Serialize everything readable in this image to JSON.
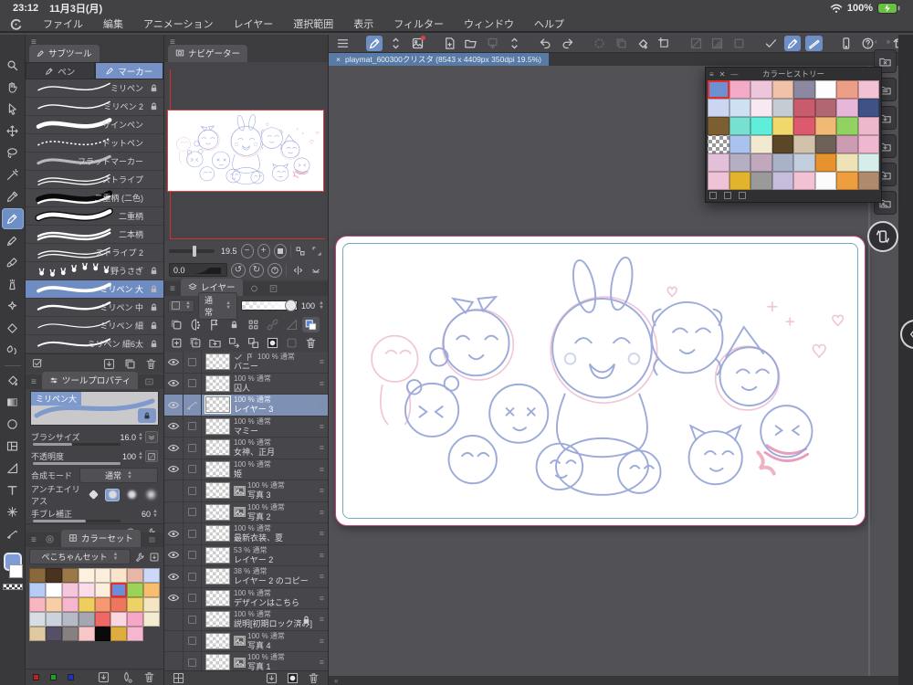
{
  "status_bar": {
    "time": "23:12",
    "date": "11月3日(月)",
    "battery": "100%"
  },
  "menu": {
    "items": [
      "ファイル",
      "編集",
      "アニメーション",
      "レイヤー",
      "選択範囲",
      "表示",
      "フィルター",
      "ウィンドウ",
      "ヘルプ"
    ]
  },
  "top_toolbar": {
    "buttons": [
      {
        "icon": "menu",
        "state": "normal"
      },
      {
        "icon": "pen-edit",
        "state": "active",
        "gap": true
      },
      {
        "icon": "chevrons",
        "state": "normal"
      },
      {
        "icon": "gallery",
        "state": "normal",
        "badge": true
      },
      {
        "icon": "new-doc",
        "state": "normal",
        "gap": true
      },
      {
        "icon": "folder-open",
        "state": "normal"
      },
      {
        "icon": "export",
        "state": "dim"
      },
      {
        "icon": "chevrons",
        "state": "normal"
      },
      {
        "icon": "undo",
        "state": "normal",
        "gap": true
      },
      {
        "icon": "redo",
        "state": "normal"
      },
      {
        "icon": "process",
        "state": "dim",
        "gap": true
      },
      {
        "icon": "duplicate",
        "state": "dim"
      },
      {
        "icon": "fill-tool",
        "state": "normal"
      },
      {
        "icon": "transform",
        "state": "normal"
      },
      {
        "icon": "select-slash",
        "state": "dim",
        "gap": true
      },
      {
        "icon": "select-half",
        "state": "dim"
      },
      {
        "icon": "select-box",
        "state": "dim"
      },
      {
        "icon": "snap-check",
        "state": "normal",
        "gap": true
      },
      {
        "icon": "snap-pen",
        "state": "active"
      },
      {
        "icon": "snap-ruler",
        "state": "active"
      },
      {
        "icon": "tablet",
        "state": "normal",
        "gap": true
      },
      {
        "icon": "help",
        "state": "normal"
      },
      {
        "icon": "rotate-canvas",
        "state": "normal",
        "gap": true
      }
    ]
  },
  "document": {
    "close_label": "×",
    "tab_title": "playmat_600300クリスタ (8543 x 4409px 350dpi 19.5%)"
  },
  "left_toolbar": {
    "foreground_color": "#7f9bd8",
    "background_color": "#ffffff",
    "tools": [
      {
        "name": "zoom",
        "icon": "magnifier"
      },
      {
        "name": "hand",
        "icon": "hand"
      },
      {
        "name": "operate",
        "icon": "cursor"
      },
      {
        "name": "move",
        "icon": "move"
      },
      {
        "name": "selection",
        "icon": "lasso"
      },
      {
        "name": "auto-select",
        "icon": "wand"
      },
      {
        "name": "eyedropper",
        "icon": "dropper"
      },
      {
        "name": "pen",
        "icon": "pen",
        "active": true
      },
      {
        "name": "pencil",
        "icon": "pencil"
      },
      {
        "name": "brush",
        "icon": "brush"
      },
      {
        "name": "airbrush",
        "icon": "spray"
      },
      {
        "name": "decoration",
        "icon": "sparkle"
      },
      {
        "name": "eraser",
        "icon": "eraser"
      },
      {
        "name": "blend",
        "icon": "blend",
        "divider_after": true
      },
      {
        "name": "fill",
        "icon": "bucket"
      },
      {
        "name": "gradient",
        "icon": "gradient"
      },
      {
        "name": "figure",
        "icon": "shape-circle"
      },
      {
        "name": "frame-border",
        "icon": "frame"
      },
      {
        "name": "ruler",
        "icon": "ruler"
      },
      {
        "name": "text",
        "icon": "text"
      },
      {
        "name": "balloon",
        "icon": "asterisk"
      },
      {
        "name": "line-correct",
        "icon": "line-fix"
      }
    ]
  },
  "subtool": {
    "title": "サブツール",
    "tabs": [
      {
        "label": "ペン",
        "active": false
      },
      {
        "label": "マーカー",
        "active": true
      }
    ],
    "brushes": [
      {
        "name": "ミリペン",
        "locked": true,
        "preview": "thin"
      },
      {
        "name": "ミリペン 2",
        "locked": true,
        "preview": "thin"
      },
      {
        "name": "サインペン",
        "locked": false,
        "preview": "thick"
      },
      {
        "name": "ドットペン",
        "locked": false,
        "preview": "dotted"
      },
      {
        "name": "フラットマーカー",
        "locked": false,
        "preview": "flat"
      },
      {
        "name": "ストライプ",
        "locked": false,
        "preview": "stripe"
      },
      {
        "name": "二重柄 (二色)",
        "locked": false,
        "preview": "dual"
      },
      {
        "name": "二重柄",
        "locked": false,
        "preview": "outline"
      },
      {
        "name": "二本柄",
        "locked": false,
        "preview": "twoline"
      },
      {
        "name": "ストライプ 2",
        "locked": false,
        "preview": "stripe2"
      },
      {
        "name": "野うさぎ",
        "locked": true,
        "preview": "bunny"
      },
      {
        "name": "ミリペン 大",
        "locked": true,
        "preview": "big",
        "selected": true
      },
      {
        "name": "ミリペン 中",
        "locked": true,
        "preview": "mid"
      },
      {
        "name": "ミリペン 細",
        "locked": true,
        "preview": "fine"
      },
      {
        "name": "ミリペン 細6太",
        "locked": true,
        "preview": "taper"
      }
    ],
    "footer_icons": [
      "checkbox-pen",
      "import-down",
      "duplicate",
      "trash"
    ]
  },
  "tool_property": {
    "title": "ツールプロパティ",
    "tool_name": "ミリペン大",
    "settings": [
      {
        "label": "ブラシサイズ",
        "value": "16.0",
        "type": "slider",
        "fill": 0.45,
        "side_icon": "double-chevron"
      },
      {
        "label": "不透明度",
        "value": "100",
        "type": "slider",
        "fill": 1,
        "side_icon": "opacity-box"
      },
      {
        "label": "合成モード",
        "value": "通常",
        "type": "dropdown"
      },
      {
        "label": "アンチエイリアス",
        "type": "buttons",
        "options": 4,
        "selected_index": 1
      },
      {
        "label": "手ブレ補正",
        "value": "60",
        "type": "slider",
        "fill": 0.6
      }
    ],
    "footer_icons": [
      "clock",
      "wrench"
    ]
  },
  "color_set": {
    "title": "カラーセット",
    "set_name": "ぺこちゃんセット",
    "header_icons": [
      "wrench",
      "import-panel"
    ],
    "selected_index": 13,
    "colors": [
      "#8a683c",
      "#483220",
      "#9a7848",
      "#fdf2e0",
      "#fceedd",
      "#fae4cc",
      "#e6b6a6",
      "#ccd8f8",
      "#b6ccf4",
      "#ffffff",
      "#f6c6dc",
      "#fbdce8",
      "#fceedd",
      "#6a8ed8",
      "#9cd258",
      "#f6be6e",
      "#f8b6c0",
      "#f8cea6",
      "#f6b6cc",
      "#eece5e",
      "#f69870",
      "#ee765e",
      "#eed266",
      "#f4e6c4",
      "#d8dce4",
      "#ccd2dc",
      "#b6bac6",
      "#a6a6b2",
      "#ee6868",
      "#fbd8e0",
      "#f6a6c6",
      "#f4ecd0",
      "#e0c8a0",
      "#565066",
      "#868080",
      "#f8c6c6",
      "#0a0a0a",
      "#dead3e",
      "#f6b6d0",
      null
    ],
    "footer_swatches": [
      "#c02020",
      "#20a020",
      "#2030c0"
    ],
    "footer_icons": [
      "import-panel",
      "droplet",
      "trash"
    ]
  },
  "navigator": {
    "title": "ナビゲーター",
    "zoom": "19.5",
    "rotation": "0.0",
    "zoom_buttons": [
      "minus",
      "plus",
      "stop"
    ],
    "rotate_buttons": [
      "rotate-ccw",
      "rotate-cw",
      "reset"
    ],
    "extra_buttons": [
      "tiles",
      "expand",
      "flip-h",
      "fit"
    ]
  },
  "layers": {
    "title": "レイヤー",
    "blend_mode": "通常",
    "opacity": "100",
    "toolbar_row1": [
      "clip",
      "tone",
      "draft",
      "lock",
      "lockalpha",
      "chain-dim",
      "ruler-dim",
      "palette-swatch"
    ],
    "toolbar_row2": [
      "new-layer",
      "new-layer2",
      "new-folder",
      "transfer",
      "merge",
      "mask",
      "dim-box",
      "trash"
    ],
    "items": [
      {
        "name": "バニー",
        "opacity": "100 %",
        "mode": "通常",
        "visible": true,
        "badges": [
          "check",
          "draft"
        ]
      },
      {
        "name": "囚人",
        "opacity": "100 %",
        "mode": "通常",
        "visible": true
      },
      {
        "name": "レイヤー 3",
        "opacity": "100 %",
        "mode": "通常",
        "visible": true,
        "selected": true,
        "editing": true
      },
      {
        "name": "マミー",
        "opacity": "100 %",
        "mode": "通常",
        "visible": true
      },
      {
        "name": "女神、正月",
        "opacity": "100 %",
        "mode": "通常",
        "visible": true
      },
      {
        "name": "姫",
        "opacity": "100 %",
        "mode": "通常",
        "visible": true
      },
      {
        "name": "写真 3",
        "opacity": "100 %",
        "mode": "通常",
        "visible": false,
        "image": true
      },
      {
        "name": "写真 2",
        "opacity": "100 %",
        "mode": "通常",
        "visible": false,
        "image": true
      },
      {
        "name": "最新衣装、夏",
        "opacity": "100 %",
        "mode": "通常",
        "visible": true
      },
      {
        "name": "レイヤー 2",
        "opacity": "53 %",
        "mode": "通常",
        "visible": true
      },
      {
        "name": "レイヤー 2 のコピー",
        "opacity": "38 %",
        "mode": "通常",
        "visible": true
      },
      {
        "name": "デザインはこちら",
        "opacity": "100 %",
        "mode": "通常",
        "visible": true
      },
      {
        "name": "説明[初期ロック済み]",
        "opacity": "100 %",
        "mode": "通常",
        "visible": false,
        "locked": true
      },
      {
        "name": "写真 4",
        "opacity": "100 %",
        "mode": "通常",
        "visible": false,
        "image": true
      },
      {
        "name": "写真 1",
        "opacity": "100 %",
        "mode": "通常",
        "visible": false,
        "image": true
      }
    ],
    "footer_icons": [
      "grid-small",
      "import-panel",
      "mask",
      "trash"
    ]
  },
  "color_history": {
    "title": "カラーヒストリー",
    "selected_index": 0,
    "colors": [
      "#6e8fd0",
      "#f2aac6",
      "#eec6dc",
      "#f0c2aa",
      "#8b88a0",
      "#fdfdfd",
      "#ec9f86",
      "#f2c2d4",
      "#ccd5f2",
      "#cfe0f2",
      "#f8e8f2",
      "#c6ccd4",
      "#c85c6c",
      "#b26672",
      "#e8b6d8",
      "#3e5288",
      "#7c5e30",
      "#78e0d0",
      "#5eeeda",
      "#f2d86c",
      "#dd5a6e",
      "#f0ba76",
      "#92d260",
      "#eeb8cc",
      "checker",
      "#aac2ee",
      "#f2ead0",
      "#5c4628",
      "#d2c2aa",
      "#6e6258",
      "#cc9cb2",
      "#f0b8d0",
      "#e2c0da",
      "#b6aec2",
      "#c2a8bc",
      "#a8b2c8",
      "#c2cede",
      "#e6932e",
      "#eee2b6",
      "#d6eeea",
      "#f0c2d8",
      "#e2b42e",
      "#9a9a9a",
      "#c6bcdc",
      "#f2c2d4",
      "#fbfbfb",
      "#ee9e3e",
      "#b08a6a"
    ],
    "footer_icons": [
      "grid-small",
      "grid-small2",
      "grid-small3"
    ]
  },
  "right_dock": {
    "buttons": [
      "folder-close",
      "folder-grid",
      "folder-down",
      "folder-down",
      "folder-down",
      "folder-image"
    ]
  }
}
